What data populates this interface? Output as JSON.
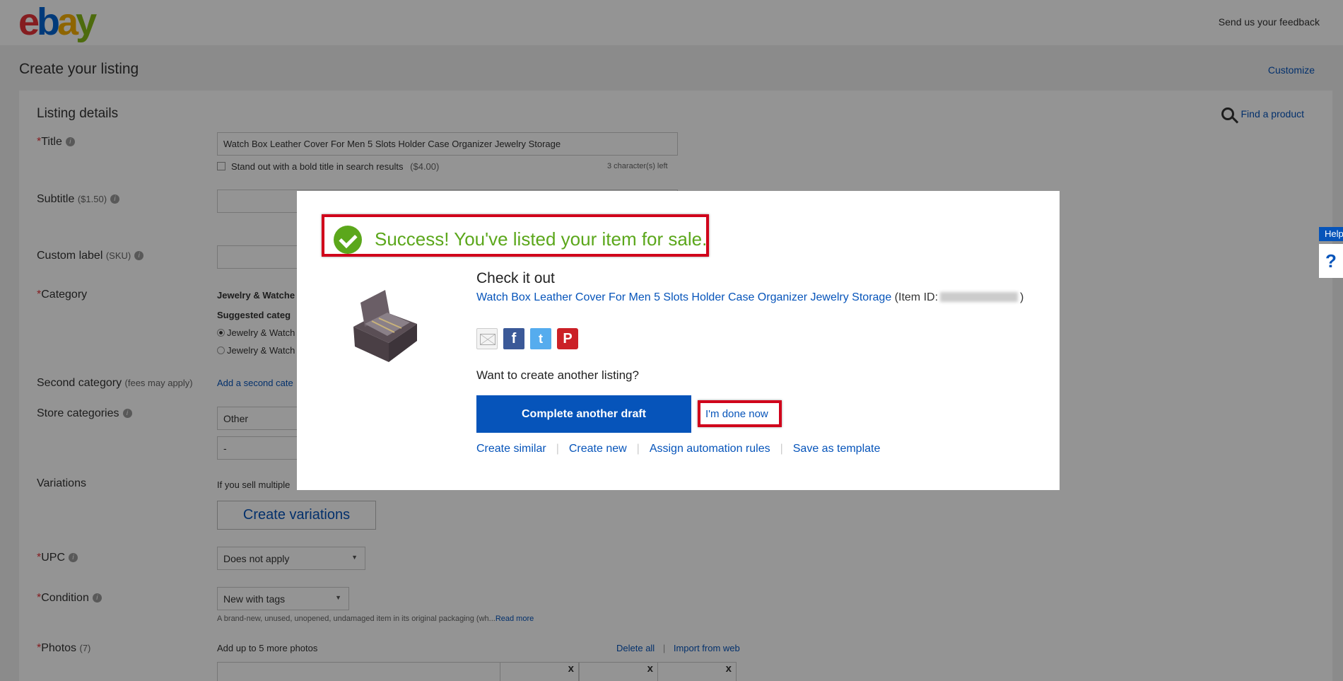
{
  "header": {
    "logo_e": "e",
    "logo_b": "b",
    "logo_a": "a",
    "logo_y": "y",
    "feedback": "Send us your feedback"
  },
  "page": {
    "title": "Create your listing",
    "customize": "Customize"
  },
  "listing": {
    "section_title": "Listing details",
    "find_product": "Find a product",
    "title_label": "Title",
    "title_value": "Watch Box Leather Cover For Men 5 Slots Holder Case Organizer Jewelry Storage",
    "bold_title": "Stand out with a bold title in search results",
    "bold_price": "($4.00)",
    "chars_left": "3 character(s) left",
    "subtitle_label": "Subtitle",
    "subtitle_price": "($1.50)",
    "sku_label": "Custom label",
    "sku_sub": "(SKU)",
    "category_label": "Category",
    "category_value": "Jewelry & Watche",
    "suggested": "Suggested categ",
    "cat_option_1": "Jewelry & Watch",
    "cat_option_2": "Jewelry & Watch",
    "second_label": "Second category",
    "second_sub": "(fees may apply)",
    "second_link": "Add a second cate",
    "store_label": "Store categories",
    "store_value_1": "Other",
    "store_value_2": "-",
    "variations_label": "Variations",
    "variations_text": "If you sell multiple",
    "create_variations": "Create variations",
    "upc_label": "UPC",
    "upc_value": "Does not apply",
    "condition_label": "Condition",
    "condition_value": "New with tags",
    "condition_desc": "A brand-new, unused, unopened, undamaged item in its original packaging (wh...",
    "read_more": "Read more",
    "photos_label": "Photos",
    "photos_count": "(7)",
    "photos_hint": "Add up to 5 more photos",
    "delete_all": "Delete all",
    "import_web": "Import from web",
    "photo_x": "x"
  },
  "modal": {
    "success": "Success! You've listed your item for sale.",
    "checkout": "Check it out",
    "item_title": "Watch Box Leather Cover For Men 5 Slots Holder Case Organizer Jewelry Storage",
    "item_id_label": "(Item ID:",
    "item_id_close": ")",
    "fb": "f",
    "tw": "t",
    "pin": "P",
    "another": "Want to create another listing?",
    "complete_draft": "Complete another draft",
    "done": "I'm done now",
    "links": [
      "Create similar",
      "Create new",
      "Assign automation rules",
      "Save as template"
    ]
  },
  "help": {
    "tab": "Help",
    "q": "?"
  }
}
